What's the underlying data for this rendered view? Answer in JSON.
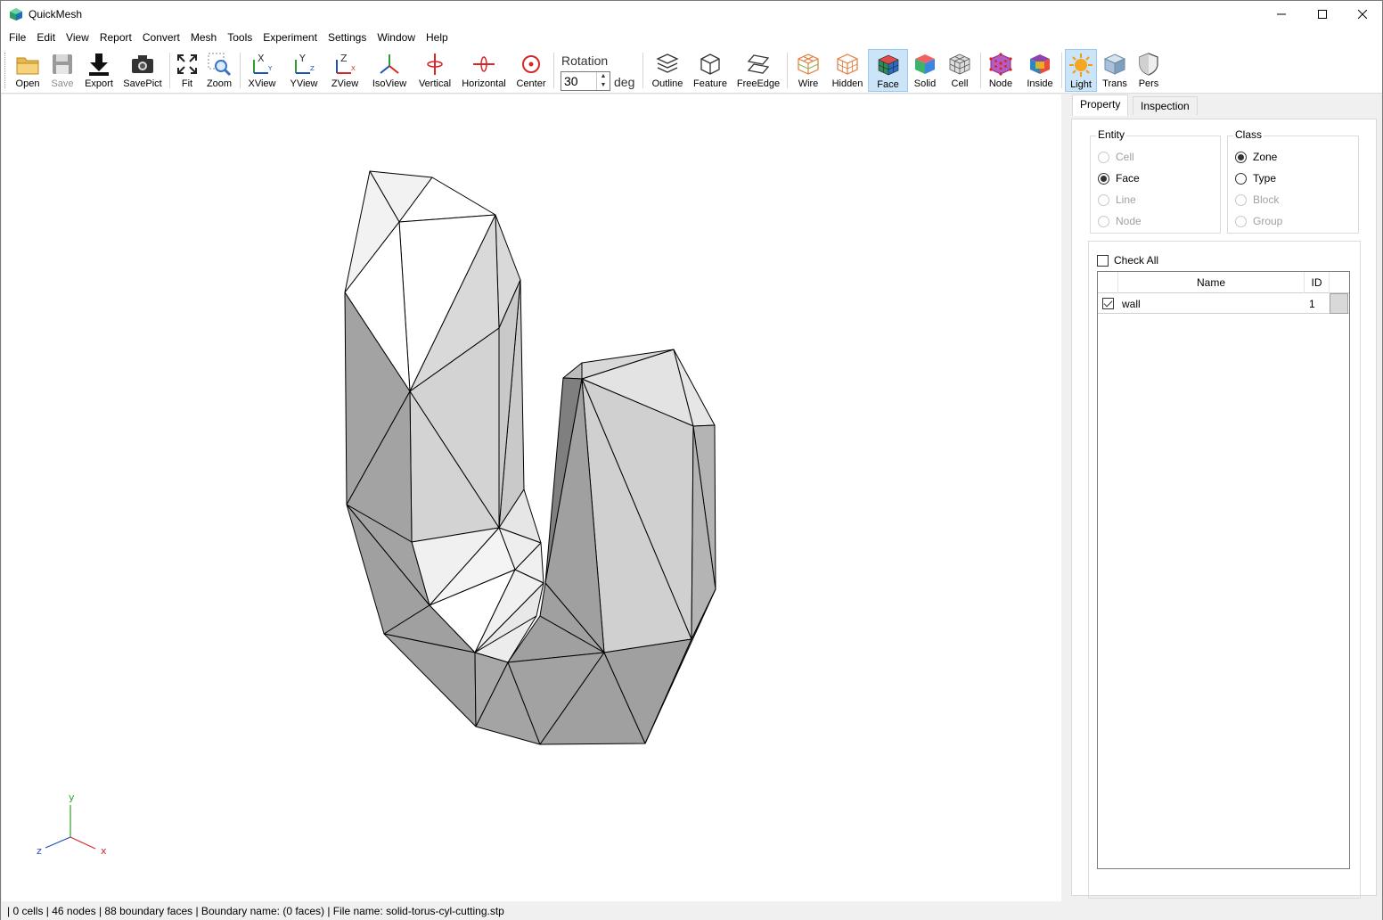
{
  "window": {
    "title": "QuickMesh"
  },
  "menu": [
    "File",
    "Edit",
    "View",
    "Report",
    "Convert",
    "Mesh",
    "Tools",
    "Experiment",
    "Settings",
    "Window",
    "Help"
  ],
  "toolbar": {
    "open": "Open",
    "save": "Save",
    "export": "Export",
    "savepict": "SavePict",
    "fit": "Fit",
    "zoom": "Zoom",
    "xview": "XView",
    "yview": "YView",
    "zview": "ZView",
    "isoview": "IsoView",
    "vertical": "Vertical",
    "horizontal": "Horizontal",
    "center": "Center",
    "rotation_label": "Rotation",
    "rotation_value": "30",
    "rotation_unit": "deg",
    "outline": "Outline",
    "feature": "Feature",
    "freeedge": "FreeEdge",
    "wire": "Wire",
    "hidden": "Hidden",
    "face": "Face",
    "solid": "Solid",
    "cell": "Cell",
    "node": "Node",
    "inside": "Inside",
    "light": "Light",
    "trans": "Trans",
    "pers": "Pers"
  },
  "axes": {
    "y": "y",
    "z": "z",
    "x": "x"
  },
  "panel": {
    "tabs": [
      "Property",
      "Inspection"
    ],
    "entity": {
      "title": "Entity",
      "options": [
        "Cell",
        "Face",
        "Line",
        "Node"
      ],
      "selected": "Face"
    },
    "class": {
      "title": "Class",
      "options": [
        "Zone",
        "Type",
        "Block",
        "Group"
      ],
      "selected": "Zone"
    },
    "check_all": "Check All",
    "table": {
      "columns": [
        "Name",
        "ID"
      ],
      "rows": [
        {
          "checked": true,
          "name": "wall",
          "id": "1"
        }
      ]
    }
  },
  "status": "| 0 cells | 46 nodes | 88 boundary faces |  Boundary name:  (0 faces) | File name: solid-torus-cyl-cutting.stp",
  "colors": {
    "accent": "#cce4f7",
    "mesh_dark": "#a0a0a0",
    "mesh_light": "#d9d9d9",
    "axis_x": "#d62728",
    "axis_y": "#2ca02c",
    "axis_z": "#1f4fbf"
  }
}
